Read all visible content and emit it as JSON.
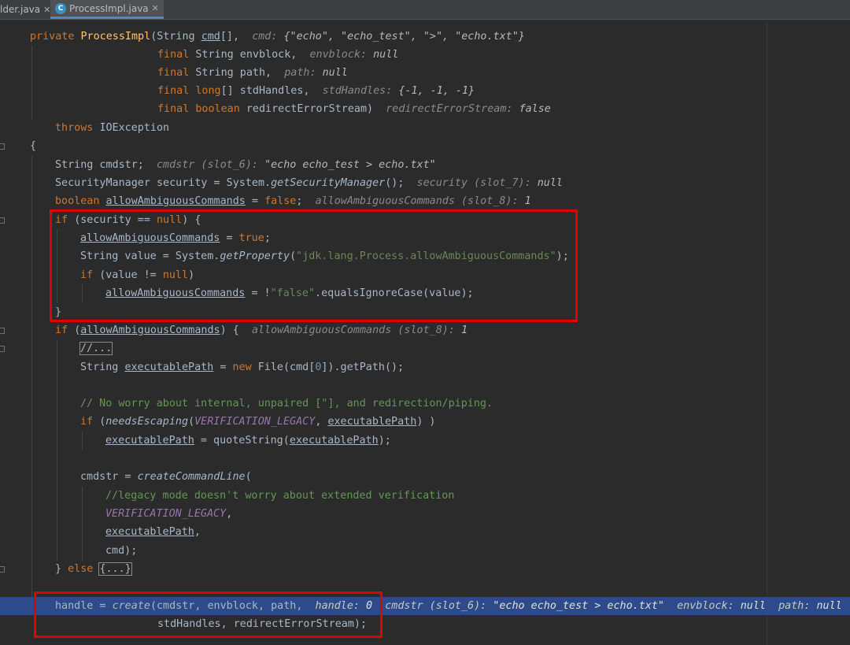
{
  "tabs": [
    {
      "label": "lder.java",
      "close": "✕",
      "icon": ""
    },
    {
      "label": "ProcessImpl.java",
      "close": "✕",
      "icon": "java-class-icon"
    }
  ],
  "code": {
    "l1": {
      "a": "private ",
      "b": "ProcessImpl",
      "c": "(String ",
      "d": "cmd",
      "e": "[],  ",
      "f": "cmd: ",
      "g": "{\"echo\", \"echo_test\", \">\", \"echo.txt\"}"
    },
    "l2": {
      "a": "final ",
      "b": "String envblock,  ",
      "c": "envblock: ",
      "d": "null"
    },
    "l3": {
      "a": "final ",
      "b": "String path,  ",
      "c": "path: ",
      "d": "null"
    },
    "l4": {
      "a": "final ",
      "b": "long",
      "c": "[] stdHandles,  ",
      "d": "stdHandles: ",
      "e": "{-1, -1, -1}"
    },
    "l5": {
      "a": "final ",
      "b": "boolean ",
      "c": "redirectErrorStream)  ",
      "d": "redirectErrorStream: ",
      "e": "false"
    },
    "l6": {
      "a": "throws ",
      "b": "IOException"
    },
    "l7": {
      "a": "{"
    },
    "l8": {
      "a": "String cmdstr;  ",
      "b": "cmdstr (slot_6): ",
      "c": "\"echo echo_test > echo.txt\""
    },
    "l9": {
      "a": "SecurityManager security = System.",
      "b": "getSecurityManager",
      "c": "();  ",
      "d": "security (slot_7): ",
      "e": "null"
    },
    "l10": {
      "a": "boolean ",
      "b": "allowAmbiguousCommands",
      "c": " = ",
      "d": "false",
      "e": ";  ",
      "f": "allowAmbiguousCommands (slot_8): ",
      "g": "1"
    },
    "l11": {
      "a": "if ",
      "b": "(security == ",
      "c": "null",
      "d": ") {"
    },
    "l12": {
      "a": "allowAmbiguousCommands",
      "b": " = ",
      "c": "true",
      "d": ";"
    },
    "l13": {
      "a": "String value = System.",
      "b": "getProperty",
      "c": "(",
      "d": "\"jdk.lang.Process.allowAmbiguousCommands\"",
      "e": ");"
    },
    "l14": {
      "a": "if ",
      "b": "(value != ",
      "c": "null",
      "d": ")"
    },
    "l15": {
      "a": "allowAmbiguousCommands",
      "b": " = !",
      "c": "\"false\"",
      "d": ".equalsIgnoreCase(value);"
    },
    "l16": {
      "a": "}"
    },
    "l17": {
      "a": "if ",
      "b": "(",
      "c": "allowAmbiguousCommands",
      "d": ") {  ",
      "e": "allowAmbiguousCommands (slot_8): ",
      "f": "1"
    },
    "l18": {
      "a": "//..."
    },
    "l19": {
      "a": "String ",
      "b": "executablePath",
      "c": " = ",
      "d": "new ",
      "e": "File(cmd[",
      "f": "0",
      "g": "]).getPath();"
    },
    "l20": {
      "a": ""
    },
    "l21": {
      "a": "// No worry about internal, unpaired [\"], and redirection/piping."
    },
    "l22": {
      "a": "if ",
      "b": "(",
      "c": "needsEscaping",
      "d": "(",
      "e": "VERIFICATION_LEGACY",
      "f": ", ",
      "g": "executablePath",
      "h": ") )"
    },
    "l23": {
      "a": "executablePath",
      "b": " = quoteString(",
      "c": "executablePath",
      "d": ");"
    },
    "l24": {
      "a": ""
    },
    "l25": {
      "a": "cmdstr = ",
      "b": "createCommandLine",
      "c": "("
    },
    "l26": {
      "a": "//legacy mode doesn't worry about extended verification"
    },
    "l27": {
      "a": "VERIFICATION_LEGACY",
      "b": ","
    },
    "l28": {
      "a": "executablePath",
      "b": ","
    },
    "l29": {
      "a": "cmd);"
    },
    "l30": {
      "a": "} ",
      "b": "else ",
      "c": "{...}"
    },
    "l31": {
      "a": ""
    },
    "l32": {
      "a": "handle",
      "b": " = ",
      "c": "create",
      "d": "(cmdstr, envblock, path,  ",
      "e": "handle: ",
      "f": "0",
      "g": "  cmdstr (slot_6): ",
      "h": "\"echo echo_test > echo.txt\"",
      "i": "  envblock: ",
      "j": "null",
      "k": "  path: ",
      "l": "null"
    },
    "l33": {
      "a": "stdHandles, redirectErrorStream);"
    }
  },
  "colors": {
    "background": "#2b2b2b",
    "keyword": "#cc7832",
    "string": "#6a8759",
    "execution_line": "#2d4a8a",
    "highlight_box": "#e00000"
  }
}
